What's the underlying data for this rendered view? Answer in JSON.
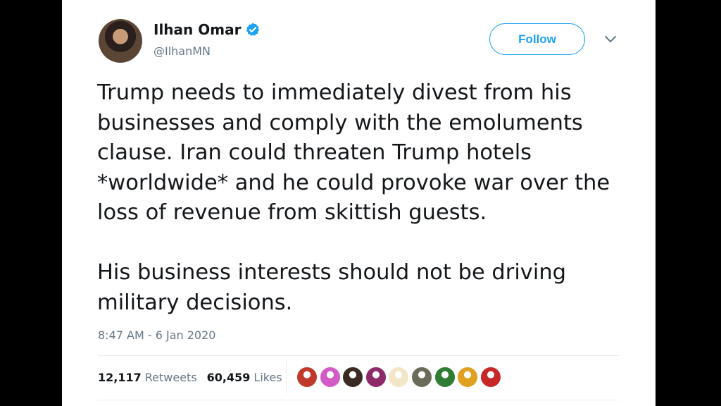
{
  "tweet": {
    "display_name": "Ilhan Omar",
    "handle": "@IlhanMN",
    "verified": true,
    "follow_label": "Follow",
    "paragraphs": [
      "Trump needs to immediately divest from his businesses and comply with the emoluments clause. Iran could threaten Trump hotels *worldwide* and he could provoke war over the loss of revenue from skittish guests.",
      "His business interests should not be driving military decisions."
    ],
    "timestamp": "8:47 AM - 6 Jan 2020",
    "stats": {
      "retweets_count": "12,117",
      "retweets_label": "Retweets",
      "likes_count": "60,459",
      "likes_label": "Likes"
    },
    "liker_avatar_colors": [
      "#c0392b",
      "#d35bc7",
      "#3a2a22",
      "#8e2a6a",
      "#f3e6c8",
      "#6b6b5a",
      "#2e7d32",
      "#e0a020",
      "#c62828"
    ]
  },
  "colors": {
    "accent": "#1da1f2",
    "text": "#14171a",
    "secondary": "#657786",
    "background": "#000000"
  },
  "icons": {
    "verified": "verified-badge-icon",
    "menu": "chevron-down-icon"
  }
}
